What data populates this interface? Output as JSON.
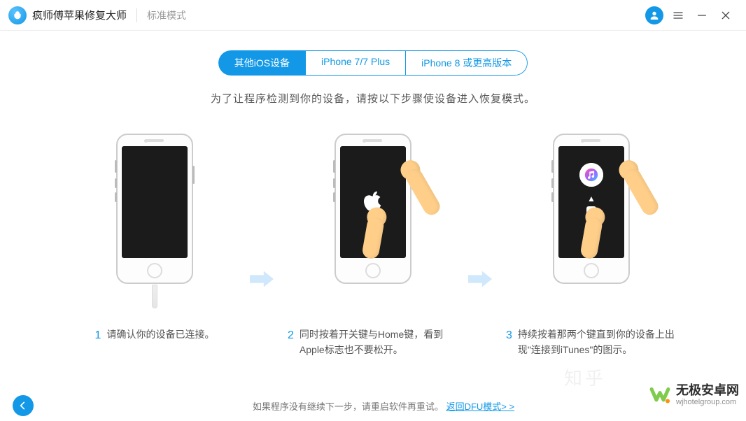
{
  "titlebar": {
    "app_name": "疯师傅苹果修复大师",
    "mode": "标准模式"
  },
  "tabs": [
    {
      "label": "其他iOS设备",
      "active": true
    },
    {
      "label": "iPhone 7/7 Plus",
      "active": false
    },
    {
      "label": "iPhone 8 或更高版本",
      "active": false
    }
  ],
  "instruction": "为了让程序检测到你的设备，请按以下步骤使设备进入恢复模式。",
  "steps": [
    {
      "num": "1",
      "text": "请确认你的设备已连接。"
    },
    {
      "num": "2",
      "text": "同时按着开关键与Home键，看到Apple标志也不要松开。"
    },
    {
      "num": "3",
      "text": "持续按着那两个键直到你的设备上出现\"连接到iTunes\"的图示。"
    }
  ],
  "footer": {
    "hint": "如果程序没有继续下一步，请重启软件再重试。",
    "link": "返回DFU模式> >"
  },
  "watermark": {
    "main": "无极安卓网",
    "sub": "wjhotelgroup.com"
  },
  "zhihu": "知乎"
}
